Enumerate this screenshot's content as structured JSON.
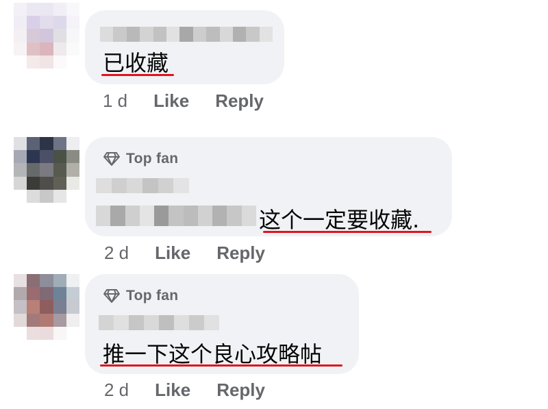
{
  "comments": [
    {
      "badge": "",
      "text": "已收藏",
      "time": "1 d",
      "like_label": "Like",
      "reply_label": "Reply"
    },
    {
      "badge": "Top fan",
      "text": "这个一定要收藏.",
      "time": "2 d",
      "like_label": "Like",
      "reply_label": "Reply"
    },
    {
      "badge": "Top fan",
      "text": "推一下这个良心攻略帖",
      "time": "2 d",
      "like_label": "Like",
      "reply_label": "Reply"
    }
  ],
  "colors": {
    "bubble": "#f0f2f5",
    "meta_text": "#65676b",
    "underline": "#e0141e",
    "body_text": "#050505"
  },
  "icons": {
    "badge": "diamond-icon"
  }
}
